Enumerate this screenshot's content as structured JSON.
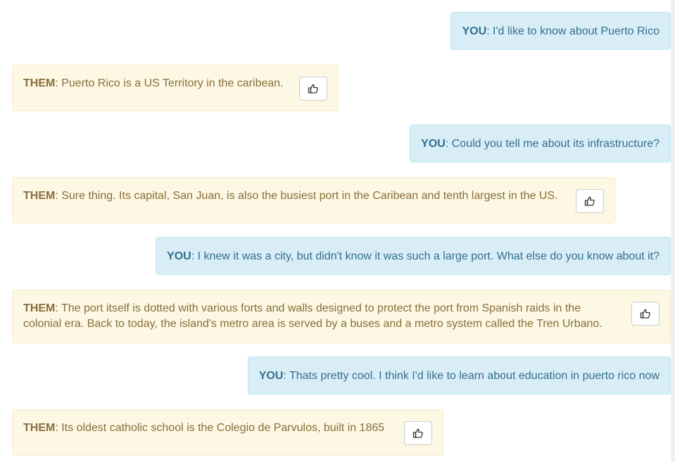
{
  "messages": [
    {
      "speaker": "YOU",
      "text": ": I'd like to know about Puerto Rico"
    },
    {
      "speaker": "THEM",
      "text": ": Puerto Rico is a US Territory in the caribean."
    },
    {
      "speaker": "YOU",
      "text": ": Could you tell me about its infrastructure?"
    },
    {
      "speaker": "THEM",
      "text": ": Sure thing. Its capital, San Juan, is also the busiest port in the Caribean and tenth largest in the US."
    },
    {
      "speaker": "YOU",
      "text": ": I knew it was a city, but didn't know it was such a large port. What else do you know about it?"
    },
    {
      "speaker": "THEM",
      "text": ": The port itself is dotted with various forts and walls designed to protect the port from Spanish raids in the colonial era. Back to today, the island's metro area is served by a buses and a metro system called the Tren Urbano."
    },
    {
      "speaker": "YOU",
      "text": ": Thats pretty cool. I think I'd like to learn about education in puerto rico now"
    },
    {
      "speaker": "THEM",
      "text": ": Its oldest catholic school is the Colegio de Parvulos, built in 1865"
    }
  ],
  "like_button_icon": "thumbs-up-icon"
}
